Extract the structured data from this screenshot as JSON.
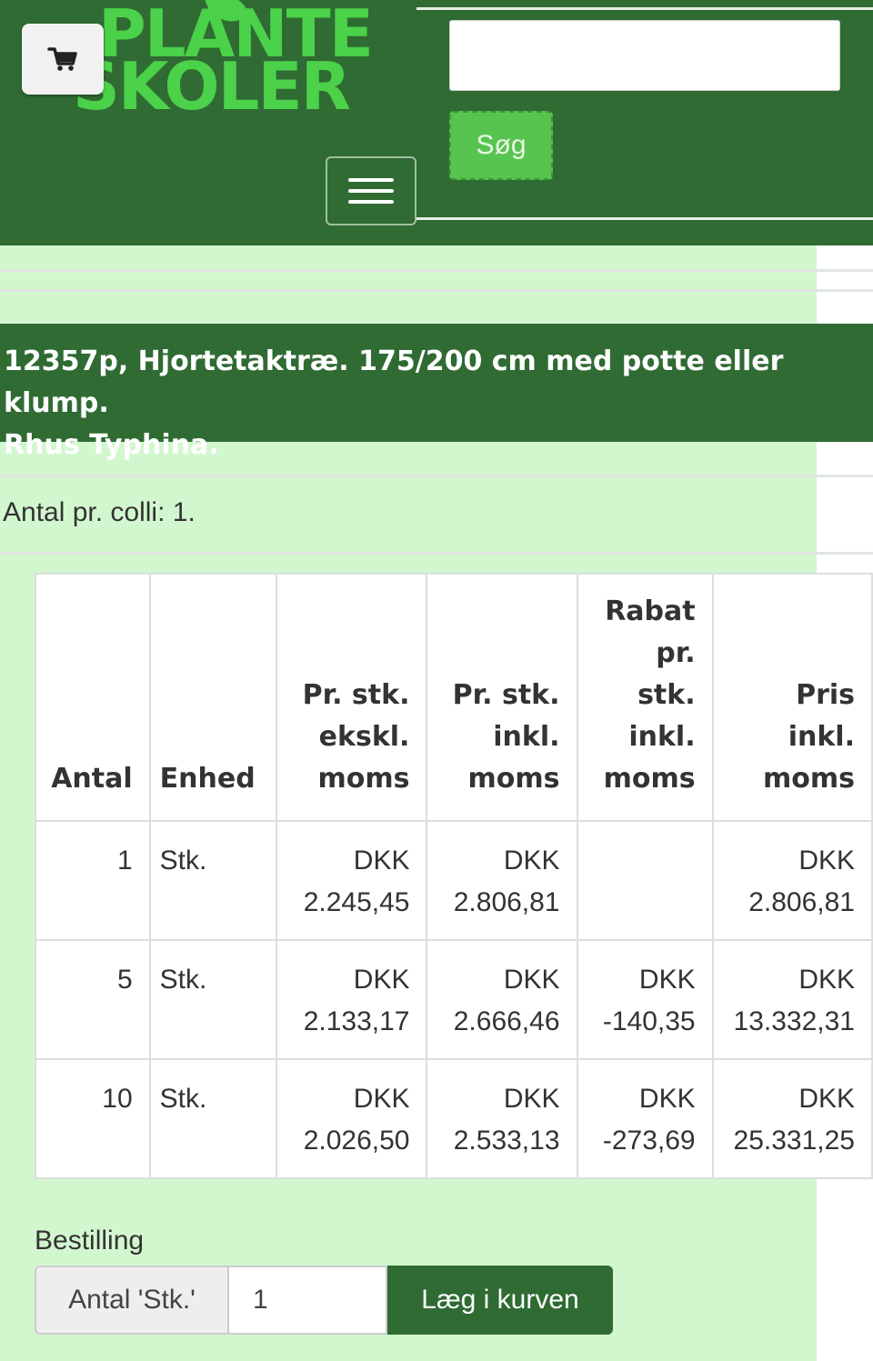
{
  "header": {
    "logo_line1": "PLANTE",
    "logo_line2": "SKOLER",
    "search_placeholder": "",
    "search_button": "Søg",
    "cart_icon": "shopping-cart-icon",
    "menu_icon": "hamburger-menu-icon"
  },
  "product": {
    "title_line1": "12357p, Hjortetaktræ. 175/200 cm med potte eller klump.",
    "title_line2": "Rhus Typhina.",
    "colli": "Antal pr. colli: 1."
  },
  "price_table": {
    "headers": [
      [
        "Antal"
      ],
      [
        "Enhed"
      ],
      [
        "Pr. stk.",
        "ekskl.",
        "moms"
      ],
      [
        "Pr. stk.",
        "inkl.",
        "moms"
      ],
      [
        "Rabat",
        "pr.",
        "stk.",
        "inkl.",
        "moms"
      ],
      [
        "Pris inkl.",
        "moms"
      ]
    ],
    "rows": [
      {
        "antal": "1",
        "enhed": "Stk.",
        "ex_l1": "DKK",
        "ex_l2": "2.245,45",
        "inkl_l1": "DKK",
        "inkl_l2": "2.806,81",
        "rabat_l1": "",
        "rabat_l2": "",
        "pris_l1": "DKK",
        "pris_l2": "2.806,81"
      },
      {
        "antal": "5",
        "enhed": "Stk.",
        "ex_l1": "DKK",
        "ex_l2": "2.133,17",
        "inkl_l1": "DKK",
        "inkl_l2": "2.666,46",
        "rabat_l1": "DKK",
        "rabat_l2": "-140,35",
        "pris_l1": "DKK",
        "pris_l2": "13.332,31"
      },
      {
        "antal": "10",
        "enhed": "Stk.",
        "ex_l1": "DKK",
        "ex_l2": "2.026,50",
        "inkl_l1": "DKK",
        "inkl_l2": "2.533,13",
        "rabat_l1": "DKK",
        "rabat_l2": "-273,69",
        "pris_l1": "DKK",
        "pris_l2": "25.331,25"
      }
    ]
  },
  "order": {
    "label": "Bestilling",
    "addon": "Antal 'Stk.'",
    "quantity": "1",
    "add_button": "Læg i kurven"
  },
  "colors": {
    "header_bg": "#2f6b33",
    "content_bg": "#d2f7cf",
    "logo_green": "#4bd14a",
    "search_button_bg": "#58c450"
  }
}
